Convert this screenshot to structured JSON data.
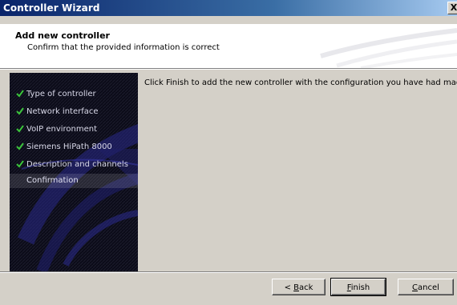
{
  "window": {
    "title": "Controller Wizard",
    "close_glyph": "X"
  },
  "header": {
    "title": "Add new controller",
    "subtitle": "Confirm that the provided information is correct"
  },
  "steps": [
    {
      "label": "Type of controller",
      "done": true
    },
    {
      "label": "Network interface",
      "done": true
    },
    {
      "label": "VoIP environment",
      "done": true
    },
    {
      "label": "Siemens HiPath 8000",
      "done": true
    },
    {
      "label": "Description and channels",
      "done": true
    },
    {
      "label": "Confirmation",
      "done": false,
      "current": true
    }
  ],
  "content": {
    "message": "Click Finish to add the new controller with the configuration you have had made."
  },
  "buttons": {
    "back": {
      "mnemonic": "B",
      "prefix": "< ",
      "rest": "ack"
    },
    "finish": {
      "mnemonic": "F",
      "rest": "inish"
    },
    "cancel": {
      "mnemonic": "C",
      "rest": "ancel"
    }
  },
  "colors": {
    "titlebar_start": "#0a246a",
    "titlebar_end": "#a6caf0",
    "check": "#3cc43c",
    "dialog_bg": "#d4d0c8"
  }
}
